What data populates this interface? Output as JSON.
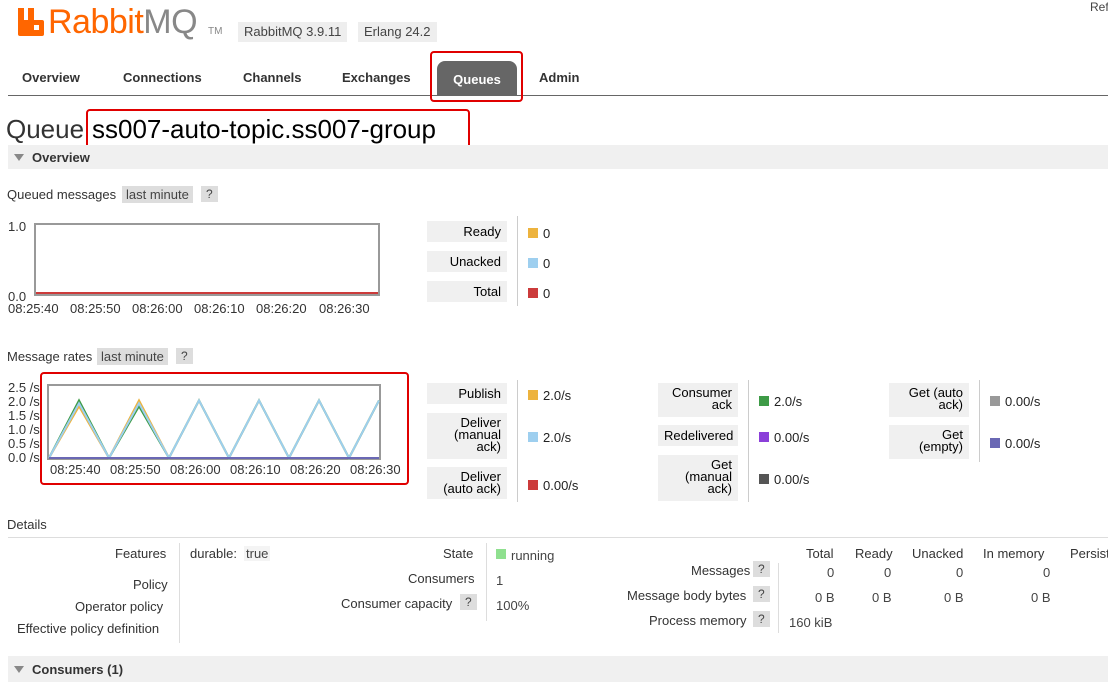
{
  "header": {
    "logo_rabbit": "Rabbit",
    "logo_mq": "MQ",
    "logo_tm": "TM",
    "rabbitmq_version": "RabbitMQ 3.9.11",
    "erlang_version": "Erlang 24.2",
    "refresh_partial": "Ref"
  },
  "nav": {
    "tabs": [
      "Overview",
      "Connections",
      "Channels",
      "Exchanges",
      "Queues",
      "Admin"
    ],
    "selected": "Queues"
  },
  "page": {
    "title_prefix": "Queue",
    "queue_name": "ss007-auto-topic.ss007-group",
    "overview_section": "Overview",
    "consumers_section": "Consumers (1)"
  },
  "queued_messages": {
    "label": "Queued messages",
    "range": "last minute",
    "help": "?",
    "y_ticks": [
      "1.0",
      "0.0"
    ],
    "x_ticks": [
      "08:25:40",
      "08:25:50",
      "08:26:00",
      "08:26:10",
      "08:26:20",
      "08:26:30"
    ],
    "stats": [
      {
        "label": "Ready",
        "value": "0",
        "color": "#edb33e"
      },
      {
        "label": "Unacked",
        "value": "0",
        "color": "#9ecfef"
      },
      {
        "label": "Total",
        "value": "0",
        "color": "#cc3b3b"
      }
    ]
  },
  "message_rates": {
    "label": "Message rates",
    "range": "last minute",
    "help": "?",
    "y_ticks": [
      "2.5 /s",
      "2.0 /s",
      "1.5 /s",
      "1.0 /s",
      "0.5 /s",
      "0.0 /s"
    ],
    "x_ticks": [
      "08:25:40",
      "08:25:50",
      "08:26:00",
      "08:26:10",
      "08:26:20",
      "08:26:30"
    ],
    "col1": [
      {
        "label_lines": [
          "Publish"
        ],
        "value": "2.0/s",
        "color": "#edb33e"
      },
      {
        "label_lines": [
          "Deliver",
          "(manual",
          "ack)"
        ],
        "value": "2.0/s",
        "color": "#9ecfef"
      },
      {
        "label_lines": [
          "Deliver",
          "(auto ack)"
        ],
        "value": "0.00/s",
        "color": "#cc3b3b"
      }
    ],
    "col2": [
      {
        "label_lines": [
          "Consumer",
          "ack"
        ],
        "value": "2.0/s",
        "color": "#3e9b47"
      },
      {
        "label_lines": [
          "Redelivered"
        ],
        "value": "0.00/s",
        "color": "#8b3fd9"
      },
      {
        "label_lines": [
          "Get",
          "(manual",
          "ack)"
        ],
        "value": "0.00/s",
        "color": "#555555"
      }
    ],
    "col3": [
      {
        "label_lines": [
          "Get (auto",
          "ack)"
        ],
        "value": "0.00/s",
        "color": "#999999"
      },
      {
        "label_lines": [
          "Get",
          "(empty)"
        ],
        "value": "0.00/s",
        "color": "#6a68b4"
      }
    ]
  },
  "chart_data": [
    {
      "type": "line",
      "title": "Queued messages",
      "x": [
        "08:25:40",
        "08:25:50",
        "08:26:00",
        "08:26:10",
        "08:26:20",
        "08:26:30"
      ],
      "ylim": [
        0,
        1.0
      ],
      "series": [
        {
          "name": "Ready",
          "values": [
            0,
            0,
            0,
            0,
            0,
            0
          ]
        },
        {
          "name": "Unacked",
          "values": [
            0,
            0,
            0,
            0,
            0,
            0
          ]
        },
        {
          "name": "Total",
          "values": [
            0,
            0,
            0,
            0,
            0,
            0
          ]
        }
      ]
    },
    {
      "type": "line",
      "title": "Message rates",
      "x_seconds": [
        0,
        5,
        10,
        15,
        20,
        25,
        30,
        35,
        40,
        45,
        50,
        55
      ],
      "x_labels": [
        "08:25:40",
        "08:25:50",
        "08:26:00",
        "08:26:10",
        "08:26:20",
        "08:26:30"
      ],
      "ylim": [
        0,
        2.5
      ],
      "series": [
        {
          "name": "Publish",
          "color": "#edb33e",
          "values": [
            0,
            1.8,
            0,
            2.0,
            0,
            2.0,
            0,
            2.0,
            0,
            2.0,
            0,
            2.0
          ]
        },
        {
          "name": "Consumer ack",
          "color": "#3e9b47",
          "values": [
            0,
            2.0,
            0,
            1.8,
            0,
            2.0,
            0,
            2.0,
            0,
            2.0,
            0,
            2.0
          ]
        },
        {
          "name": "Deliver (manual ack)",
          "color": "#9ecfef",
          "values": [
            0,
            1.9,
            0,
            1.9,
            0,
            2.0,
            0,
            2.0,
            0,
            2.0,
            0,
            2.0
          ]
        },
        {
          "name": "Get (empty)",
          "color": "#6a68b4",
          "values": [
            0,
            0,
            0,
            0,
            0,
            0,
            0,
            0,
            0,
            0,
            0,
            0
          ]
        }
      ]
    }
  ],
  "details": {
    "label": "Details",
    "features_label": "Features",
    "durable_key": "durable:",
    "durable_value": "true",
    "policy_label": "Policy",
    "operator_policy_label": "Operator policy",
    "effective_policy_label": "Effective policy definition",
    "state_label": "State",
    "state_value": "running",
    "state_color": "#8fe08f",
    "consumers_label": "Consumers",
    "consumers_value": "1",
    "consumer_capacity_label": "Consumer capacity",
    "consumer_capacity_value": "100%",
    "help": "?",
    "table_headers": [
      "Total",
      "Ready",
      "Unacked",
      "In memory",
      "Persist"
    ],
    "rows": [
      {
        "label": "Messages",
        "values": [
          "0",
          "0",
          "0",
          "0"
        ]
      },
      {
        "label": "Message body bytes",
        "values": [
          "0 B",
          "0 B",
          "0 B",
          "0 B"
        ]
      },
      {
        "label": "Process memory",
        "values": [
          "160 kiB"
        ]
      }
    ]
  }
}
